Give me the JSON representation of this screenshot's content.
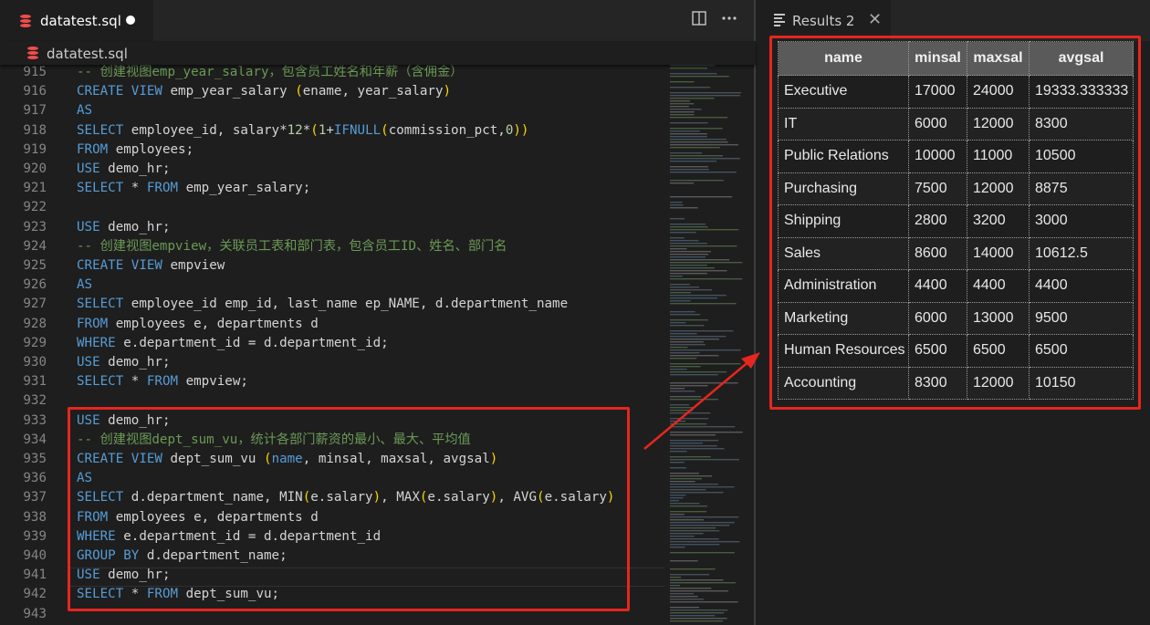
{
  "editor": {
    "tab_title": "datatest.sql",
    "breadcrumb": "datatest.sql",
    "split_icon": "split-editor-icon",
    "more_icon": "more-actions-icon",
    "lines": [
      {
        "n": "915",
        "parts": [
          [
            "cm",
            "-- 创建视图emp_year_salary，包含员工姓名和年薪（含佣金）"
          ]
        ]
      },
      {
        "n": "916",
        "parts": [
          [
            "kw",
            "CREATE VIEW"
          ],
          [
            "tx",
            " emp_year_salary "
          ],
          [
            "pr",
            "("
          ],
          [
            "tx",
            "ename, year_salary"
          ],
          [
            "pr",
            ")"
          ]
        ]
      },
      {
        "n": "917",
        "parts": [
          [
            "kw",
            "AS"
          ]
        ]
      },
      {
        "n": "918",
        "parts": [
          [
            "kw",
            "SELECT"
          ],
          [
            "tx",
            " employee_id, salary*"
          ],
          [
            "nm",
            "12"
          ],
          [
            "tx",
            "*"
          ],
          [
            "pr",
            "("
          ],
          [
            "nm",
            "1"
          ],
          [
            "tx",
            "+"
          ],
          [
            "kw",
            "IFNULL"
          ],
          [
            "pr",
            "("
          ],
          [
            "tx",
            "commission_pct,"
          ],
          [
            "nm",
            "0"
          ],
          [
            "pr",
            "))"
          ]
        ]
      },
      {
        "n": "919",
        "parts": [
          [
            "kw",
            "FROM"
          ],
          [
            "tx",
            " employees;"
          ]
        ]
      },
      {
        "n": "920",
        "parts": [
          [
            "kw",
            "USE"
          ],
          [
            "tx",
            " demo_hr;"
          ]
        ]
      },
      {
        "n": "921",
        "parts": [
          [
            "kw",
            "SELECT"
          ],
          [
            "tx",
            " * "
          ],
          [
            "kw",
            "FROM"
          ],
          [
            "tx",
            " emp_year_salary;"
          ]
        ]
      },
      {
        "n": "922",
        "parts": []
      },
      {
        "n": "923",
        "parts": [
          [
            "kw",
            "USE"
          ],
          [
            "tx",
            " demo_hr;"
          ]
        ]
      },
      {
        "n": "924",
        "parts": [
          [
            "cm",
            "-- 创建视图empview，关联员工表和部门表，包含员工ID、姓名、部门名"
          ]
        ]
      },
      {
        "n": "925",
        "parts": [
          [
            "kw",
            "CREATE VIEW"
          ],
          [
            "tx",
            " empview"
          ]
        ]
      },
      {
        "n": "926",
        "parts": [
          [
            "kw",
            "AS"
          ]
        ]
      },
      {
        "n": "927",
        "parts": [
          [
            "kw",
            "SELECT"
          ],
          [
            "tx",
            " employee_id emp_id, last_name ep_NAME, d.department_name"
          ]
        ]
      },
      {
        "n": "928",
        "parts": [
          [
            "kw",
            "FROM"
          ],
          [
            "tx",
            " employees e, departments d"
          ]
        ]
      },
      {
        "n": "929",
        "parts": [
          [
            "kw",
            "WHERE"
          ],
          [
            "tx",
            " e.department_id = d.department_id;"
          ]
        ]
      },
      {
        "n": "930",
        "parts": [
          [
            "kw",
            "USE"
          ],
          [
            "tx",
            " demo_hr;"
          ]
        ]
      },
      {
        "n": "931",
        "parts": [
          [
            "kw",
            "SELECT"
          ],
          [
            "tx",
            " * "
          ],
          [
            "kw",
            "FROM"
          ],
          [
            "tx",
            " empview;"
          ]
        ]
      },
      {
        "n": "932",
        "parts": []
      },
      {
        "n": "933",
        "parts": [
          [
            "kw",
            "USE"
          ],
          [
            "tx",
            " demo_hr;"
          ]
        ]
      },
      {
        "n": "934",
        "parts": [
          [
            "cm",
            "-- 创建视图dept_sum_vu，统计各部门薪资的最小、最大、平均值"
          ]
        ]
      },
      {
        "n": "935",
        "parts": [
          [
            "kw",
            "CREATE VIEW"
          ],
          [
            "tx",
            " dept_sum_vu "
          ],
          [
            "pr",
            "("
          ],
          [
            "kw",
            "name"
          ],
          [
            "tx",
            ", minsal, maxsal, avgsal"
          ],
          [
            "pr",
            ")"
          ]
        ]
      },
      {
        "n": "936",
        "parts": [
          [
            "kw",
            "AS"
          ]
        ]
      },
      {
        "n": "937",
        "parts": [
          [
            "kw",
            "SELECT"
          ],
          [
            "tx",
            " d.department_name, MIN"
          ],
          [
            "pr",
            "("
          ],
          [
            "tx",
            "e.salary"
          ],
          [
            "pr",
            ")"
          ],
          [
            "tx",
            ", MAX"
          ],
          [
            "pr",
            "("
          ],
          [
            "tx",
            "e.salary"
          ],
          [
            "pr",
            ")"
          ],
          [
            "tx",
            ", AVG"
          ],
          [
            "pr",
            "("
          ],
          [
            "tx",
            "e.salary"
          ],
          [
            "pr",
            ")"
          ]
        ]
      },
      {
        "n": "938",
        "parts": [
          [
            "kw",
            "FROM"
          ],
          [
            "tx",
            " employees e, departments d"
          ]
        ]
      },
      {
        "n": "939",
        "parts": [
          [
            "kw",
            "WHERE"
          ],
          [
            "tx",
            " e.department_id = d.department_id"
          ]
        ]
      },
      {
        "n": "940",
        "parts": [
          [
            "kw",
            "GROUP BY"
          ],
          [
            "tx",
            " d.department_name;"
          ]
        ]
      },
      {
        "n": "941",
        "parts": [
          [
            "kw",
            "USE"
          ],
          [
            "tx",
            " demo_hr;"
          ]
        ]
      },
      {
        "n": "942",
        "parts": [
          [
            "kw",
            "SELECT"
          ],
          [
            "tx",
            " * "
          ],
          [
            "kw",
            "FROM"
          ],
          [
            "tx",
            " dept_sum_vu;"
          ]
        ]
      },
      {
        "n": "943",
        "parts": []
      }
    ]
  },
  "results": {
    "tab_title": "Results 2",
    "close_glyph": "✕",
    "columns": [
      "name",
      "minsal",
      "maxsal",
      "avgsal"
    ],
    "rows": [
      [
        "Executive",
        "17000",
        "24000",
        "19333.333333"
      ],
      [
        "IT",
        "6000",
        "12000",
        "8300"
      ],
      [
        "Public Relations",
        "10000",
        "11000",
        "10500"
      ],
      [
        "Purchasing",
        "7500",
        "12000",
        "8875"
      ],
      [
        "Shipping",
        "2800",
        "3200",
        "3000"
      ],
      [
        "Sales",
        "8600",
        "14000",
        "10612.5"
      ],
      [
        "Administration",
        "4400",
        "4400",
        "4400"
      ],
      [
        "Marketing",
        "6000",
        "13000",
        "9500"
      ],
      [
        "Human Resources",
        "6500",
        "6500",
        "6500"
      ],
      [
        "Accounting",
        "8300",
        "12000",
        "10150"
      ]
    ]
  },
  "colors": {
    "keyword": "#569cd6",
    "comment": "#6a9955",
    "number": "#b5cea8",
    "bracket": "#ffd700",
    "annotation": "#e6261f"
  }
}
